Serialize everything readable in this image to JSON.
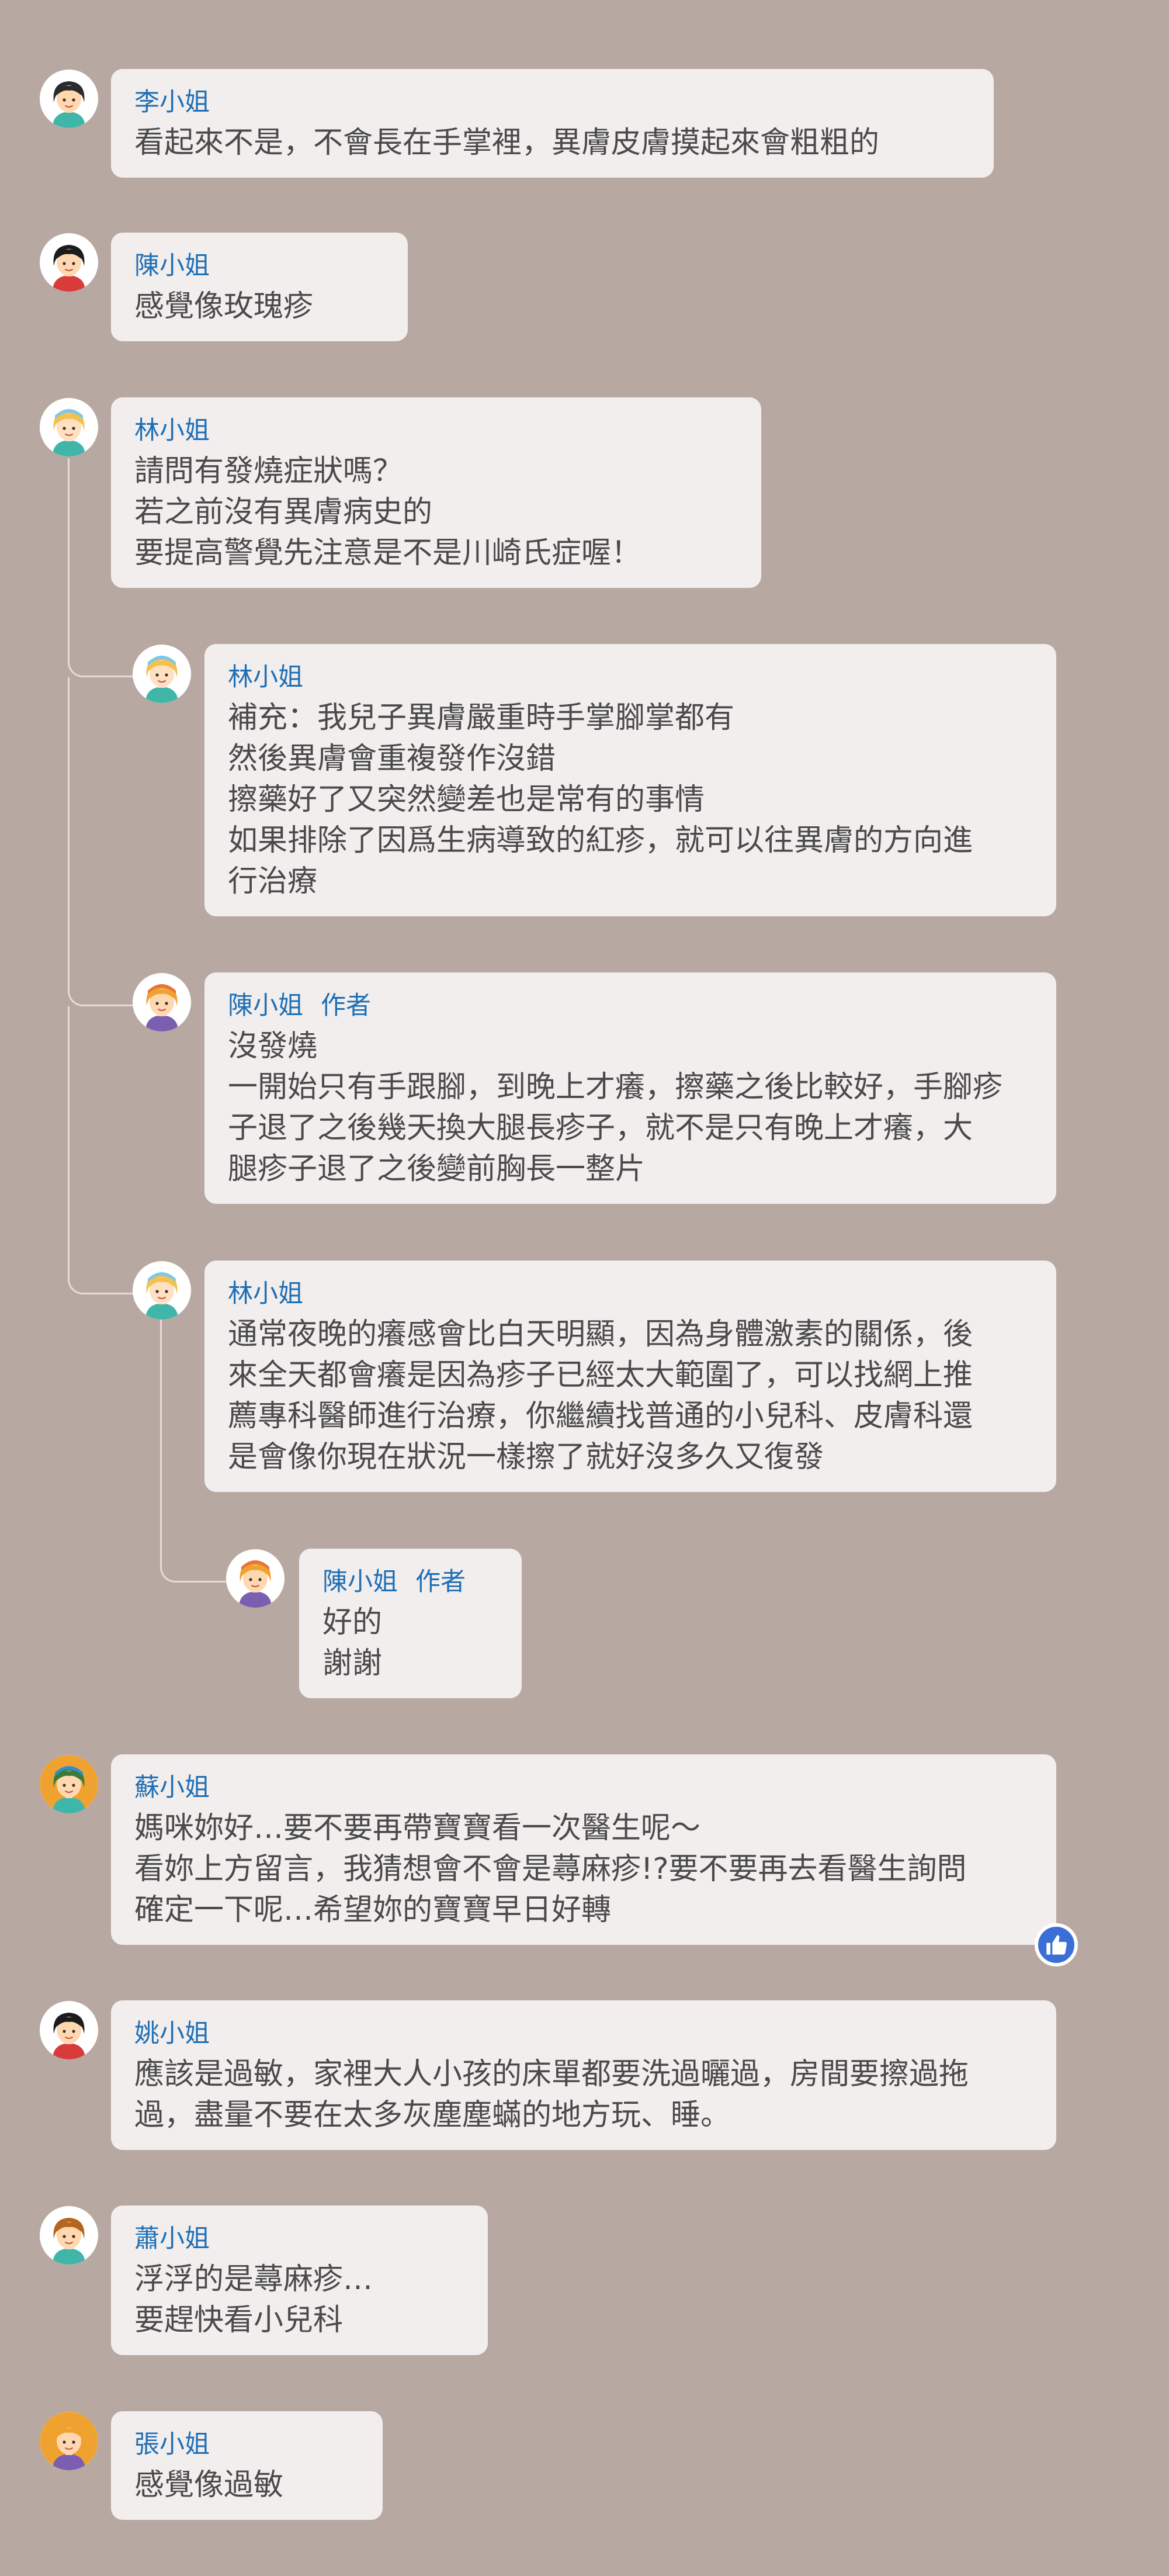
{
  "comments": [
    {
      "name": "李小姐",
      "avatar": "woman-avatar-icon",
      "lines": [
        "看起來不是，不會長在手掌裡，異膚皮膚摸起來會粗粗的"
      ]
    },
    {
      "name": "陳小姐",
      "avatar": "woman-avatar-icon",
      "lines": [
        "感覺像玫瑰疹"
      ]
    },
    {
      "name": "林小姐",
      "avatar": "woman-avatar-icon",
      "lines": [
        "請問有發燒症狀嗎？",
        "若之前沒有異膚病史的",
        "要提高警覺先注意是不是川崎氏症喔！"
      ]
    },
    {
      "name": "林小姐",
      "avatar": "woman-avatar-icon",
      "lines": [
        "補充：我兒子異膚嚴重時手掌腳掌都有",
        "然後異膚會重複發作沒錯",
        "擦藥好了又突然變差也是常有的事情",
        "如果排除了因爲生病導致的紅疹，就可以往異膚的方向進",
        "行治療"
      ]
    },
    {
      "name": "陳小姐",
      "tag": "作者",
      "avatar": "woman-avatar-icon",
      "lines": [
        "沒發燒",
        "一開始只有手跟腳，到晚上才癢，擦藥之後比較好，手腳疹",
        "子退了之後幾天換大腿長疹子，就不是只有晚上才癢，大",
        "腿疹子退了之後變前胸長一整片"
      ]
    },
    {
      "name": "林小姐",
      "avatar": "woman-avatar-icon",
      "lines": [
        "通常夜晚的癢感會比白天明顯，因為身體激素的關係，後",
        "來全天都會癢是因為疹子已經太大範圍了，可以找網上推",
        "薦專科醫師進行治療，你繼續找普通的小兒科、皮膚科還",
        "是會像你現在狀況一樣擦了就好沒多久又復發"
      ]
    },
    {
      "name": "陳小姐",
      "tag": "作者",
      "avatar": "woman-avatar-icon",
      "lines": [
        "好的",
        "謝謝"
      ]
    },
    {
      "name": "蘇小姐",
      "avatar": "woman-avatar-icon",
      "lines": [
        "媽咪妳好…要不要再帶寶寶看一次醫生呢～",
        "看妳上方留言，我猜想會不會是蕁麻疹!?要不要再去看醫生詢問",
        "確定一下呢…希望妳的寶寶早日好轉"
      ],
      "reaction": "thumbs-up-icon"
    },
    {
      "name": "姚小姐",
      "avatar": "woman-avatar-icon",
      "lines": [
        "應該是過敏，家裡大人小孩的床單都要洗過曬過，房間要擦過拖",
        "過，盡量不要在太多灰塵塵蟎的地方玩、睡。"
      ]
    },
    {
      "name": "蕭小姐",
      "avatar": "woman-avatar-icon",
      "lines": [
        "浮浮的是蕁麻疹…",
        "要趕快看小兒科"
      ]
    },
    {
      "name": "張小姐",
      "avatar": "woman-avatar-icon",
      "lines": [
        "感覺像過敏"
      ]
    }
  ],
  "colors": {
    "background": "#b8a8a2",
    "bubble": "#f2eeee",
    "name": "#1f6fb5",
    "text": "#4a4a4a",
    "like": "#3b6fd6"
  }
}
